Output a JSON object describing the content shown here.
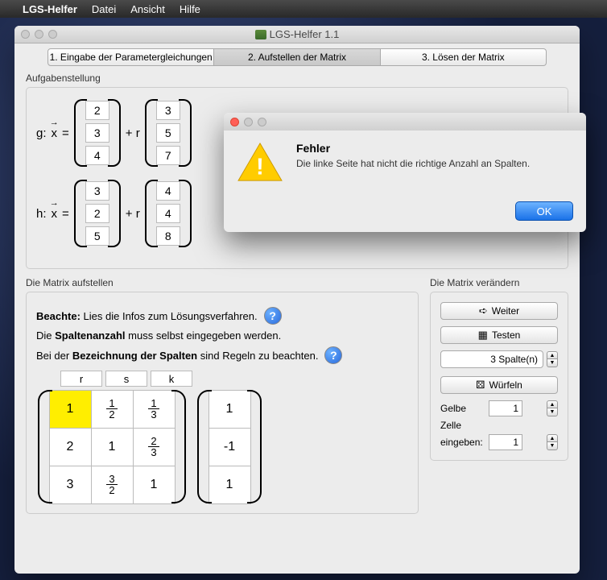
{
  "menubar": {
    "apple": "",
    "appname": "LGS-Helfer",
    "items": [
      "Datei",
      "Ansicht",
      "Hilfe"
    ]
  },
  "window": {
    "title": "LGS-Helfer 1.1"
  },
  "tabs": [
    "1. Eingabe der Parametergleichungen",
    "2. Aufstellen der Matrix",
    "3. Lösen der Matrix"
  ],
  "active_tab": 1,
  "section1": {
    "label": "Aufgabenstellung",
    "g": {
      "prefix": "g:",
      "vec": "x",
      "eq": "=",
      "v1": [
        "2",
        "3",
        "4"
      ],
      "plus": "+ r",
      "v2": [
        "3",
        "5",
        "7"
      ]
    },
    "h": {
      "prefix": "h:",
      "vec": "x",
      "eq": "=",
      "v1": [
        "3",
        "2",
        "5"
      ],
      "plus": "+ r",
      "v2": [
        "4",
        "4",
        "8"
      ]
    }
  },
  "section2": {
    "label": "Die Matrix aufstellen",
    "line1_b": "Beachte:",
    "line1": "Lies die Infos zum Lösungsverfahren.",
    "line2a": "Die ",
    "line2b": "Spaltenanzahl",
    "line2c": " muss selbst eingegeben werden.",
    "line3a": "Bei der ",
    "line3b": "Bezeichnung der Spalten",
    "line3c": " sind Regeln zu beachten.",
    "help": "?",
    "col_headers": [
      "r",
      "s",
      "k"
    ],
    "matrixA": [
      [
        "1",
        "1/2",
        "1/3"
      ],
      [
        "2",
        "1",
        "2/3"
      ],
      [
        "3",
        "3/2",
        "1"
      ]
    ],
    "matrixB": [
      "1",
      "-1",
      "1"
    ],
    "highlight": [
      0,
      0
    ]
  },
  "section3": {
    "label": "Die Matrix verändern",
    "btn_weiter": "Weiter",
    "btn_testen": "Testen",
    "spalten": "3 Spalte(n)",
    "btn_wuerfeln": "Würfeln",
    "gelbe_l1": "Gelbe",
    "gelbe_l2": "Zelle",
    "gelbe_l3": "eingeben:",
    "val1": "1",
    "val2": "1"
  },
  "dialog": {
    "title": "Fehler",
    "message": "Die linke Seite hat nicht die richtige Anzahl an Spalten.",
    "ok": "OK"
  }
}
